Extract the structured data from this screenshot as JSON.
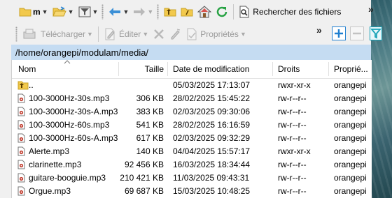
{
  "toolbar": {
    "drive_label": "m",
    "search_label": "Rechercher des fichiers",
    "download_label": "Télécharger",
    "edit_label": "Éditer",
    "properties_label": "Propriétés",
    "overflow_label": "»"
  },
  "address": {
    "path": "/home/orangepi/modulam/media/"
  },
  "columns": {
    "name": "Nom",
    "size": "Taille",
    "date": "Date de modification",
    "rights": "Droits",
    "owner": "Propriétaire",
    "owner_visible": "Proprié..."
  },
  "files": [
    {
      "name": "..",
      "size": "",
      "date": "05/03/2025 17:13:07",
      "rights": "rwxr-xr-x",
      "owner": "orangepi",
      "icon": "parent-folder-icon"
    },
    {
      "name": "100-3000Hz-30s.mp3",
      "size": "306 KB",
      "date": "28/02/2025 15:45:22",
      "rights": "rw-r--r--",
      "owner": "orangepi",
      "icon": "audio-file-icon"
    },
    {
      "name": "100-3000Hz-30s-A.mp3",
      "size": "383 KB",
      "date": "02/03/2025 09:30:06",
      "rights": "rw-r--r--",
      "owner": "orangepi",
      "icon": "audio-file-icon"
    },
    {
      "name": "100-3000Hz-60s.mp3",
      "size": "541 KB",
      "date": "28/02/2025 16:16:59",
      "rights": "rw-r--r--",
      "owner": "orangepi",
      "icon": "audio-file-icon"
    },
    {
      "name": "100-3000Hz-60s-A.mp3",
      "size": "617 KB",
      "date": "02/03/2025 09:32:29",
      "rights": "rw-r--r--",
      "owner": "orangepi",
      "icon": "audio-file-icon"
    },
    {
      "name": "Alerte.mp3",
      "size": "140 KB",
      "date": "04/04/2025 15:57:17",
      "rights": "rwxr-xr-x",
      "owner": "orangepi",
      "icon": "audio-file-icon"
    },
    {
      "name": "clarinette.mp3",
      "size": "92 456 KB",
      "date": "16/03/2025 18:34:44",
      "rights": "rw-r--r--",
      "owner": "orangepi",
      "icon": "audio-file-icon"
    },
    {
      "name": "guitare-booguie.mp3",
      "size": "210 421 KB",
      "date": "11/03/2025 09:43:31",
      "rights": "rw-r--r--",
      "owner": "orangepi",
      "icon": "audio-file-icon"
    },
    {
      "name": "Orgue.mp3",
      "size": "69 687 KB",
      "date": "15/03/2025 10:48:25",
      "rights": "rw-r--r--",
      "owner": "orangepi",
      "icon": "audio-file-icon"
    }
  ],
  "colors": {
    "address_bar": "#c5dcf2",
    "folder": "#f2c94c",
    "nav_arrow": "#3b8fd6",
    "refresh": "#27a243",
    "add": "#1f7fd0",
    "filter_active": "#19a3b8"
  }
}
